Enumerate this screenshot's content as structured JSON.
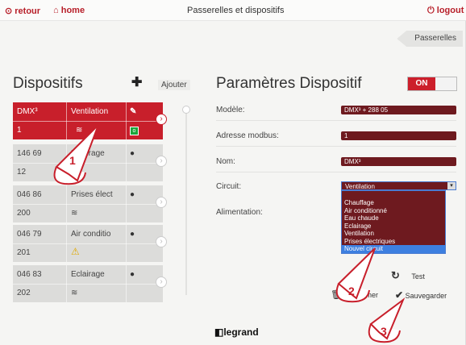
{
  "topbar": {
    "back_label": "retour",
    "home_label": "home",
    "title": "Passerelles et dispositifs",
    "logout_label": "logout"
  },
  "breadcrumb": {
    "label": "Passerelles"
  },
  "devices": {
    "heading": "Dispositifs",
    "add_label": "Ajouter",
    "items": [
      {
        "col1": "DMX³",
        "col2": "Ventilation",
        "sub1": "1",
        "sub2": "wifi",
        "selected": true
      },
      {
        "col1": "146 69",
        "col2": "Eclairage",
        "sub1": "12",
        "sub2": "",
        "selected": false
      },
      {
        "col1": "046 86",
        "col2": "Prises élect",
        "sub1": "200",
        "sub2": "wifi",
        "selected": false
      },
      {
        "col1": "046 79",
        "col2": "Air conditio",
        "sub1": "201",
        "sub2": "warning",
        "selected": false
      },
      {
        "col1": "046 83",
        "col2": "Eclairage",
        "sub1": "202",
        "sub2": "wifi",
        "selected": false
      }
    ]
  },
  "params": {
    "heading": "Paramètres Dispositif",
    "toggle_label": "ON",
    "model_label": "Modèle:",
    "model_value": "DMX³ + 288 05",
    "address_label": "Adresse modbus:",
    "address_value": "1",
    "name_label": "Nom:",
    "name_value": "DMX³",
    "circuit_label": "Circuit:",
    "circuit_value": "Ventilation",
    "power_label": "Alimentation:",
    "circuit_options": [
      "Chauffage",
      "Air conditionné",
      "Eau chaude",
      "Eclairage",
      "Ventilation",
      "Prises électriques",
      "Nouvel circuit"
    ],
    "test_label": "Test",
    "delete_label": "rimer",
    "save_label": "Sauvegarder"
  },
  "brand": "legrand",
  "callouts": [
    "1",
    "2",
    "3"
  ],
  "colors": {
    "accent": "#c81f2b",
    "field": "#6e1a1f",
    "highlight": "#3d7fe0"
  }
}
